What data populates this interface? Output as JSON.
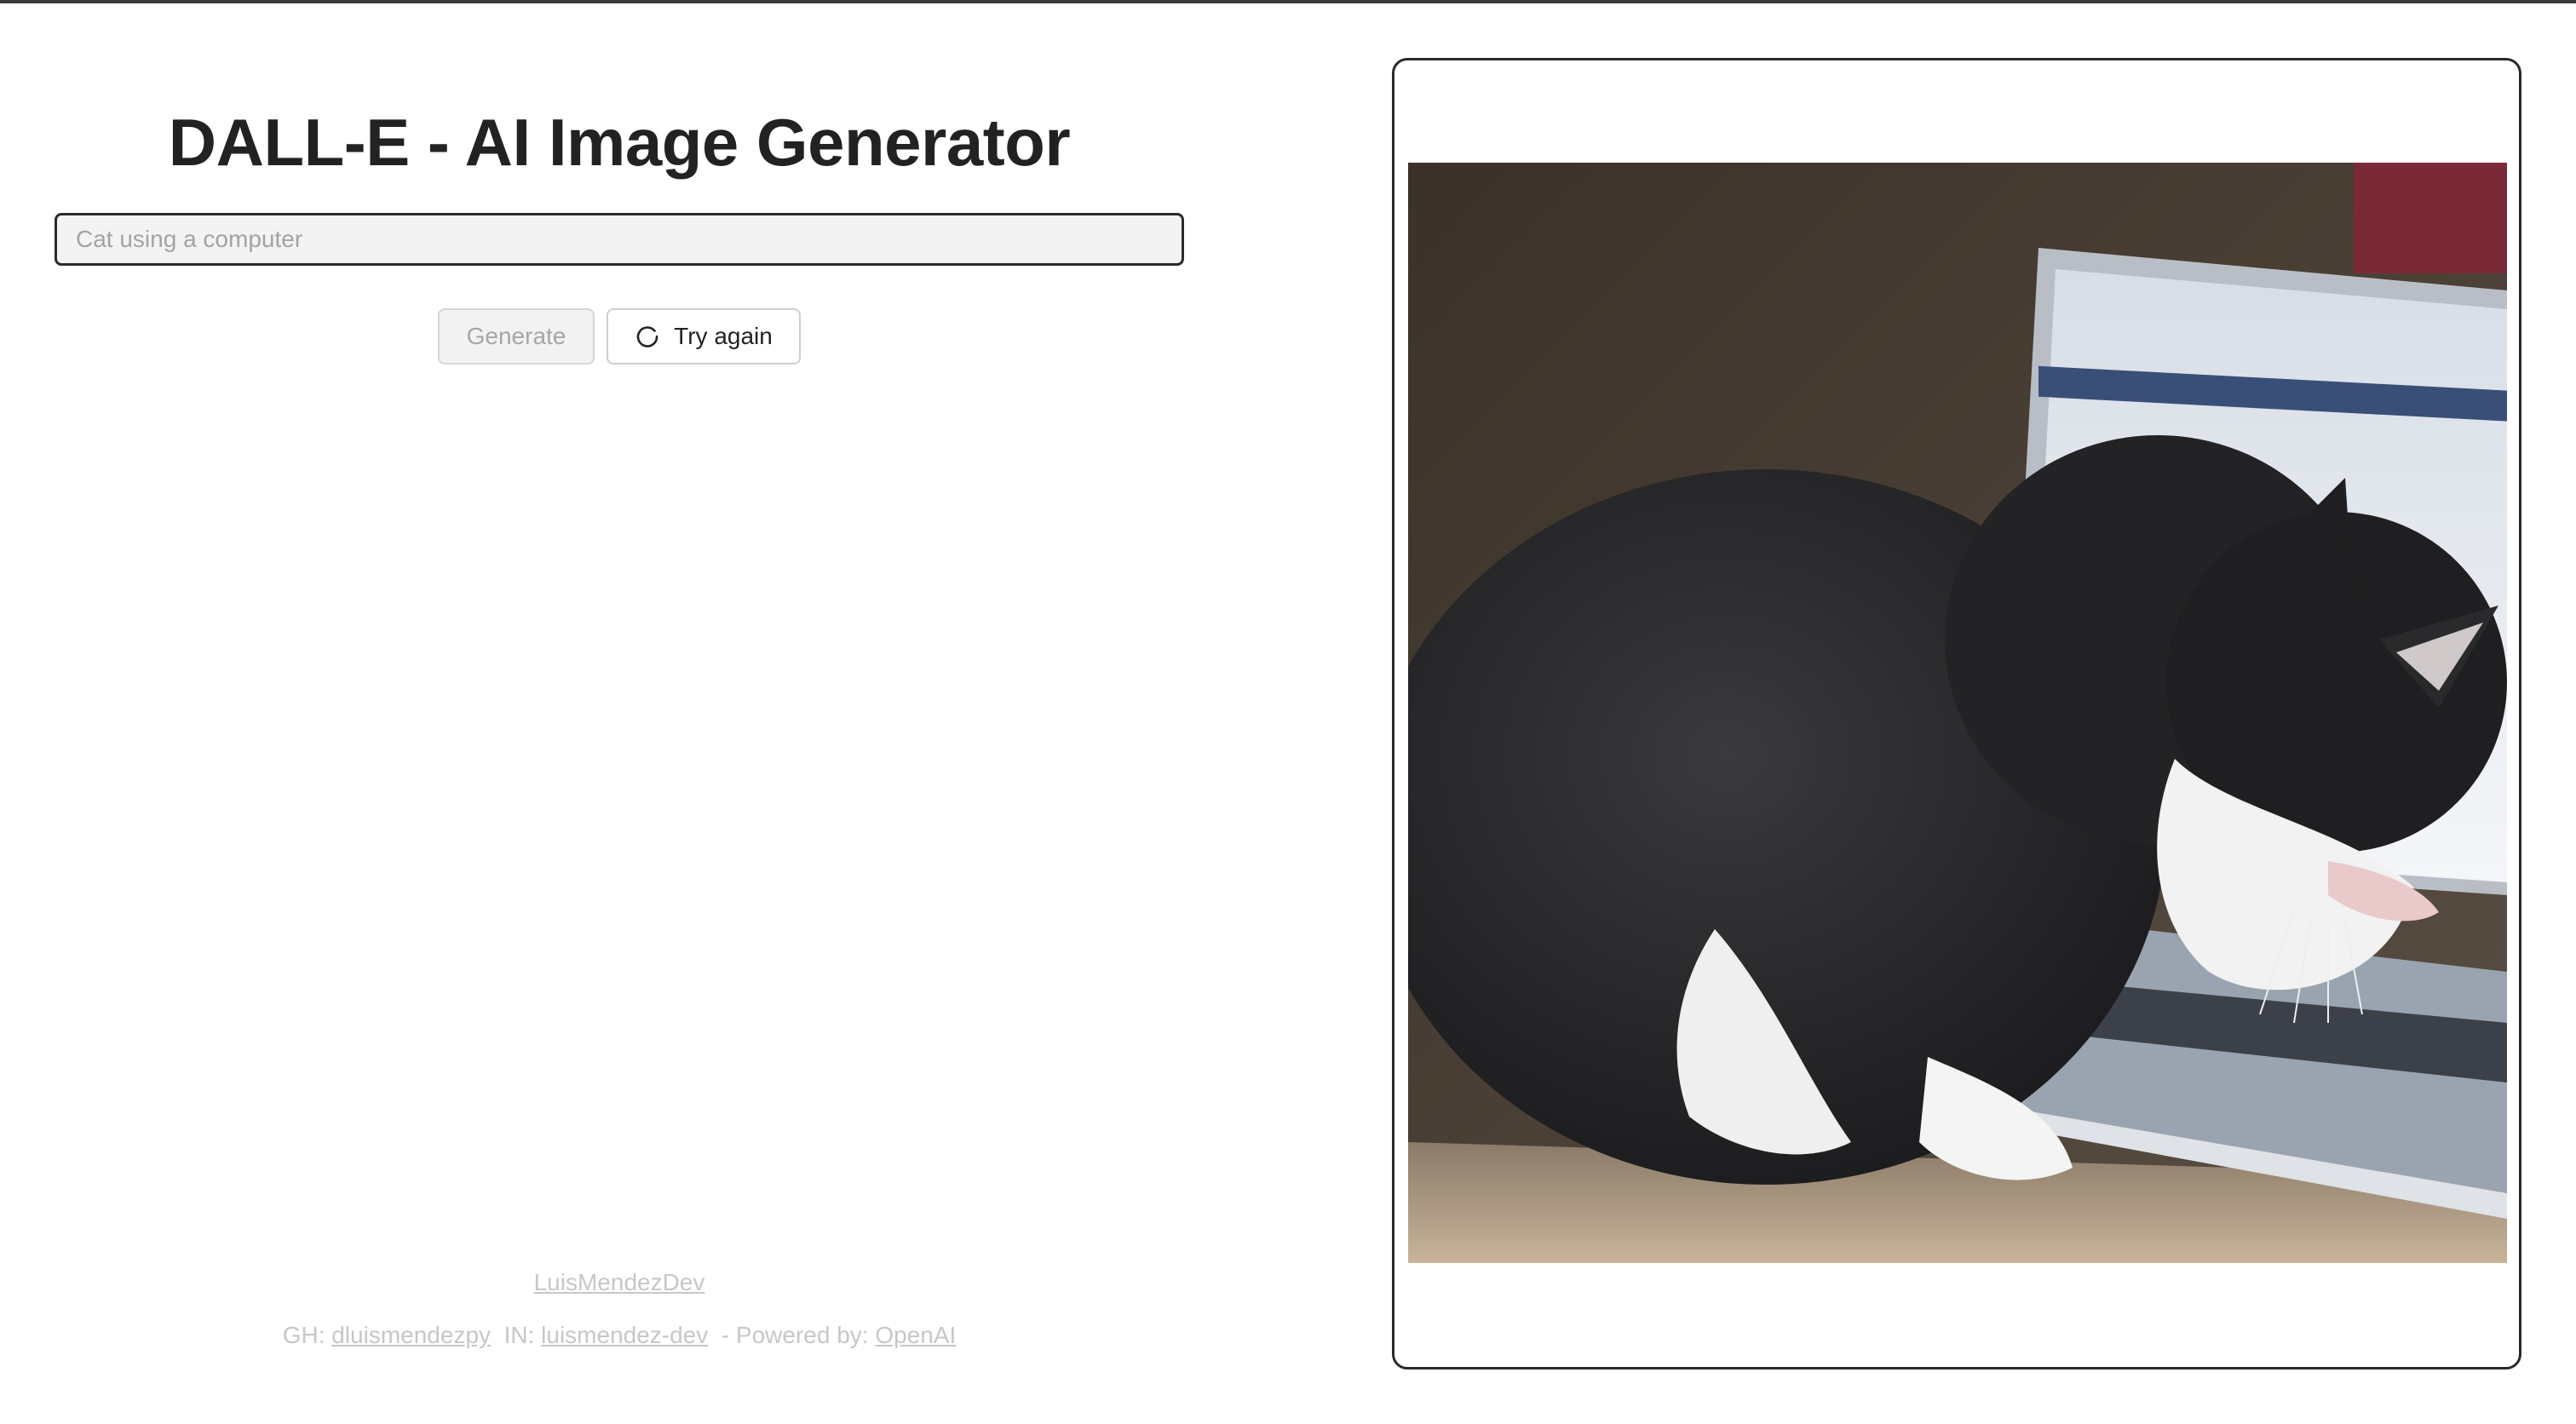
{
  "header": {
    "title": "DALL-E - AI Image Generator"
  },
  "prompt": {
    "value": "",
    "placeholder": "Cat using a computer"
  },
  "actions": {
    "generate_label": "Generate",
    "retry_label": "Try again",
    "retry_icon": "refresh-icon"
  },
  "footer": {
    "author": "LuisMendezDev",
    "gh_prefix": "GH: ",
    "gh_link": "dluismendezpy",
    "in_prefix": "  IN: ",
    "in_link": "luismendez-dev",
    "powered_prefix": "  - Powered by: ",
    "powered_link": "OpenAI"
  },
  "result": {
    "image_alt": "Cat using a computer"
  },
  "colors": {
    "title": "#222222",
    "input_border": "#2b2b2b",
    "input_bg": "#f3f3f3",
    "footer_text": "#c7c7c7",
    "card_border": "#2a2a2a"
  }
}
